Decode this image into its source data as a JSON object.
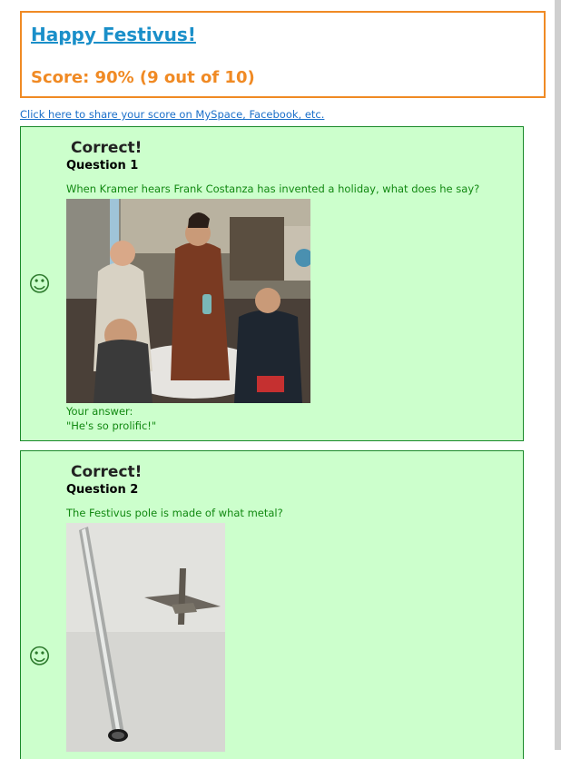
{
  "header": {
    "title": "Happy Festivus!",
    "score": "Score: 90% (9 out of 10)"
  },
  "share_link": "Click here to share your score on MySpace, Facebook, etc.",
  "questions": [
    {
      "icon": "smiley-icon",
      "verdict": "Correct!",
      "number": "Question 1",
      "text": "When Kramer hears Frank Costanza has invented a holiday, what does he say?",
      "image": "seinfeld-diner-scene-photo",
      "answer_label": "Your answer:",
      "answer": "\"He's so prolific!\""
    },
    {
      "icon": "smiley-icon",
      "verdict": "Correct!",
      "number": "Question 2",
      "text": "The Festivus pole is made of what metal?",
      "image": "aluminum-pole-and-stand-photo"
    }
  ],
  "colors": {
    "title_link": "#1a8fc9",
    "score": "#f08a24",
    "box_border": "#f08a24",
    "correct_bg": "#ccffcc",
    "correct_border": "#1a8a2a",
    "question_text": "#118811"
  }
}
